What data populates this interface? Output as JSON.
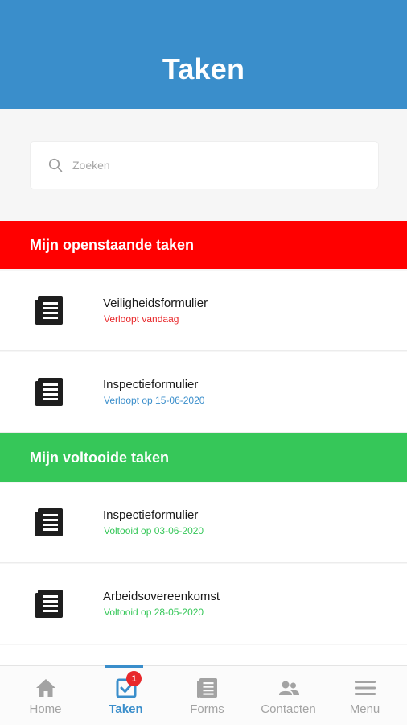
{
  "header": {
    "title": "Taken"
  },
  "search": {
    "placeholder": "Zoeken"
  },
  "sections": [
    {
      "title": "Mijn openstaande taken",
      "color": "#ff0000",
      "items": [
        {
          "title": "Veiligheidsformulier",
          "status": "Verloopt vandaag",
          "status_color": "#e8282b"
        },
        {
          "title": "Inspectieformulier",
          "status": "Verloopt op 15-06-2020",
          "status_color": "#3a8ecb"
        }
      ]
    },
    {
      "title": "Mijn voltooide taken",
      "color": "#36c759",
      "items": [
        {
          "title": "Inspectieformulier",
          "status": "Voltooid op 03-06-2020",
          "status_color": "#36c759"
        },
        {
          "title": "Arbeidsovereenkomst",
          "status": "Voltooid op 28-05-2020",
          "status_color": "#36c759"
        }
      ]
    }
  ],
  "tabbar": {
    "tabs": [
      {
        "label": "Home",
        "icon": "home-icon"
      },
      {
        "label": "Taken",
        "icon": "tasks-icon",
        "active": true
      },
      {
        "label": "Forms",
        "icon": "forms-icon"
      },
      {
        "label": "Contacten",
        "icon": "contacts-icon"
      },
      {
        "label": "Menu",
        "icon": "menu-icon"
      }
    ],
    "badge": "1"
  },
  "colors": {
    "brand": "#3a8ecb",
    "inactive_tab": "#a3a3a3"
  }
}
